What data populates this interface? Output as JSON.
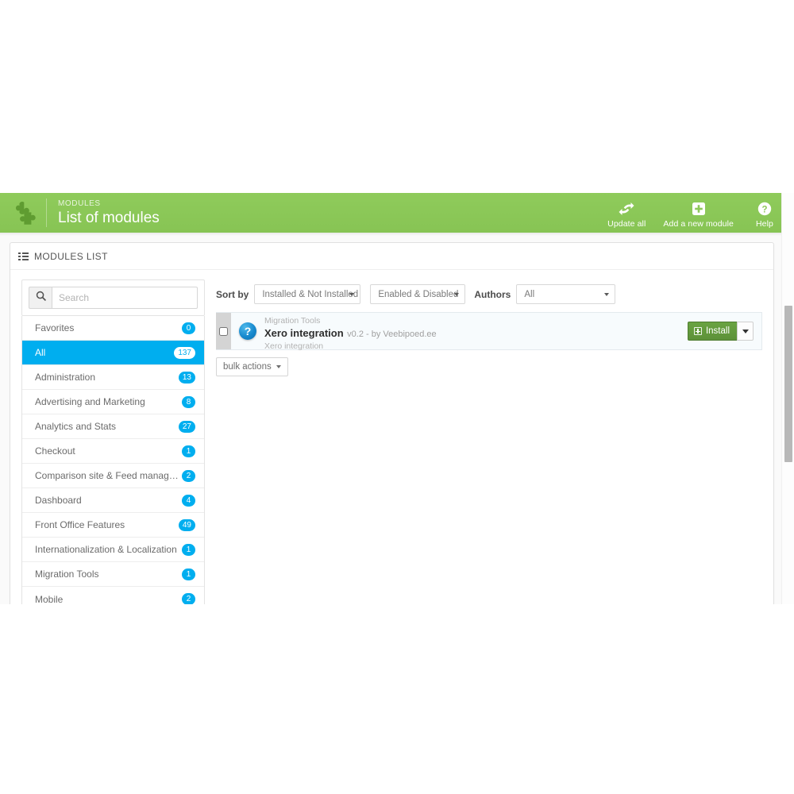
{
  "header": {
    "breadcrumb": "MODULES",
    "title": "List of modules",
    "icon": "puzzle-piece-icon",
    "bg_color": "#8ec85a",
    "actions": [
      {
        "label": "Update all",
        "icon": "refresh-icon"
      },
      {
        "label": "Add a new module",
        "icon": "plus-square-icon"
      },
      {
        "label": "Help",
        "icon": "question-circle-icon"
      }
    ]
  },
  "panel": {
    "title": "MODULES LIST",
    "icon": "list-icon"
  },
  "search": {
    "placeholder": "Search",
    "value": "",
    "icon": "search-icon"
  },
  "categories": [
    {
      "label": "Favorites",
      "count": "0",
      "active": false
    },
    {
      "label": "All",
      "count": "137",
      "active": true
    },
    {
      "label": "Administration",
      "count": "13",
      "active": false
    },
    {
      "label": "Advertising and Marketing",
      "count": "8",
      "active": false
    },
    {
      "label": "Analytics and Stats",
      "count": "27",
      "active": false
    },
    {
      "label": "Checkout",
      "count": "1",
      "active": false
    },
    {
      "label": "Comparison site & Feed management",
      "count": "2",
      "active": false
    },
    {
      "label": "Dashboard",
      "count": "4",
      "active": false
    },
    {
      "label": "Front Office Features",
      "count": "49",
      "active": false
    },
    {
      "label": "Internationalization & Localization",
      "count": "1",
      "active": false
    },
    {
      "label": "Migration Tools",
      "count": "1",
      "active": false
    },
    {
      "label": "Mobile",
      "count": "2",
      "active": false
    }
  ],
  "filters": {
    "sort_by_label": "Sort by",
    "authors_label": "Authors",
    "installed_value": "Installed & Not Installed",
    "enabled_value": "Enabled & Disabled",
    "authors_value": "All"
  },
  "modules": [
    {
      "category": "Migration Tools",
      "name": "Xero integration",
      "meta": "v0.2 - by Veebipoed.ee",
      "description": "Xero integration",
      "icon": "question-mark-module-icon",
      "action_label": "Install",
      "checked": false
    }
  ],
  "bulk": {
    "label": "bulk actions"
  },
  "colors": {
    "header_green": "#8ec85a",
    "accent_blue": "#00aeef",
    "install_green": "#5d9139",
    "row_bg": "#f7fbfd"
  }
}
